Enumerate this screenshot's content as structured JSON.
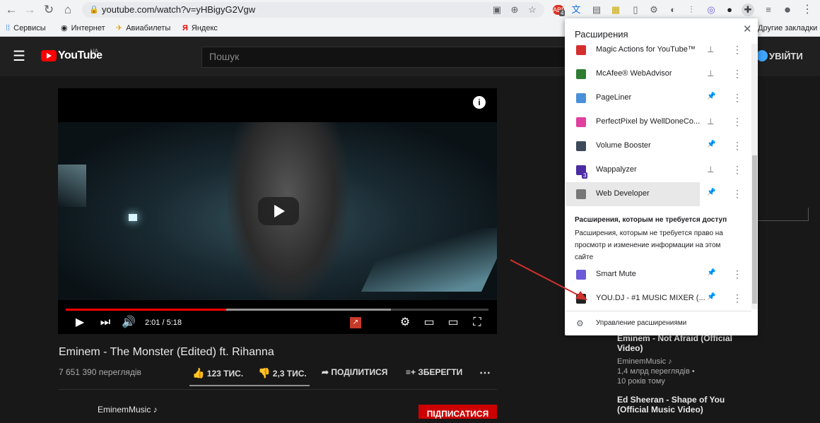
{
  "browser": {
    "url": "youtube.com/watch?v=yHBigyG2Vgw",
    "bookmarks": [
      {
        "label": "Сервисы",
        "icon": "apps-grid-icon"
      },
      {
        "label": "Интернет",
        "icon": "globe-icon"
      },
      {
        "label": "Авиабилеты",
        "icon": "plane-icon"
      },
      {
        "label": "Яндекс",
        "icon": "yandex-icon"
      }
    ],
    "other_bookmarks": "Другие закладки",
    "badge_count": "4",
    "ext_badge": "3"
  },
  "youtube": {
    "logo": "YouTube",
    "logo_region": "UA",
    "search_placeholder": "Пошук",
    "signin": "УВІЙТИ",
    "player": {
      "time": "2:01 / 5:18",
      "progress": 0.38,
      "buffered": 0.77
    },
    "video_title": "Eminem - The Monster (Edited) ft. Rihanna",
    "views": "7 651 390 переглядів",
    "likes": "123 ТИС.",
    "dislikes": "2,3 ТИС.",
    "share": "ПОДІЛИТИСЯ",
    "save": "ЗБЕРЕГТИ",
    "channel": "EminemMusic ♪",
    "subscribe": "ПІДПИСАТИСЯ",
    "sidebar": [
      {
        "title": "Eminem - Not Afraid (Official Video)",
        "channel": "EminemMusic ♪",
        "views": "1,4 млрд переглядів •",
        "age": "10 років тому"
      },
      {
        "title": "Ed Sheeran - Shape of You (Official Music Video)"
      }
    ]
  },
  "extensions": {
    "title": "Расширения",
    "items": [
      {
        "name": "Magic Actions for YouTube™",
        "pinned": false,
        "color": "#d32f2f"
      },
      {
        "name": "McAfee® WebAdvisor",
        "pinned": false,
        "color": "#2e7d32"
      },
      {
        "name": "PageLiner",
        "pinned": true,
        "color": "#4a90d9"
      },
      {
        "name": "PerfectPixel by WellDoneCo...",
        "pinned": false,
        "color": "#e040a0"
      },
      {
        "name": "Volume Booster",
        "pinned": true,
        "color": "#3c4a5a"
      },
      {
        "name": "Wappalyzer",
        "pinned": false,
        "color": "#4b2ca3"
      },
      {
        "name": "Web Developer",
        "pinned": true,
        "color": "#777777"
      }
    ],
    "no_access_heading": "Расширения, которым не требуется доступ",
    "no_access_text": "Расширения, которым не требуется право на просмотр и изменение информации на этом сайте",
    "no_access_items": [
      {
        "name": "Smart Mute",
        "pinned": true,
        "color": "#6b5bd6"
      },
      {
        "name": "YOU.DJ - #1 MUSIC MIXER (...",
        "pinned": true,
        "color": "#222222"
      }
    ],
    "manage": "Управление расширениями"
  },
  "colors": {
    "accent_red": "#ff0000",
    "pin_blue": "#1a73e8",
    "arrow": "#d0312d"
  }
}
